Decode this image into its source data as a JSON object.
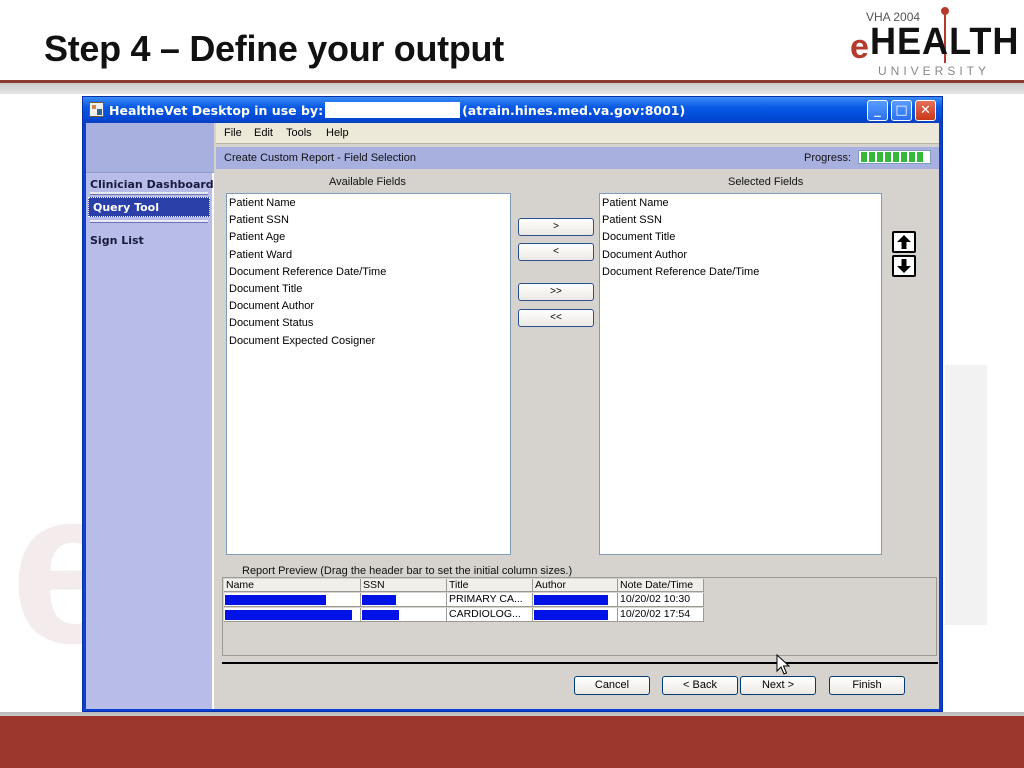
{
  "slide": {
    "title": "Step 4 – Define your output",
    "logo": {
      "top": "VHA 2004",
      "e": "e",
      "main": "HEALTH",
      "sub": "UNIVERSITY"
    }
  },
  "window": {
    "title_prefix": "HealtheVet Desktop in use by:",
    "title_suffix": "(atrain.hines.med.va.gov:8001)",
    "controls": {
      "minimize": "_",
      "maximize": "□",
      "close": "✕"
    }
  },
  "sidebar": {
    "items": [
      {
        "label": "Clinician Dashboard"
      },
      {
        "label": "Query Tool"
      },
      {
        "label": "Sign List"
      }
    ]
  },
  "menu": [
    {
      "label": "File"
    },
    {
      "label": "Edit"
    },
    {
      "label": "Tools"
    },
    {
      "label": "Help"
    }
  ],
  "header": {
    "title": "Create Custom Report - Field Selection",
    "progress_label": "Progress:",
    "progress_value": 0.95
  },
  "available": {
    "label": "Available Fields",
    "items": [
      "Patient Name",
      "Patient SSN",
      "Patient Age",
      "Patient Ward",
      "Document Reference Date/Time",
      "Document Title",
      "Document Author",
      "Document Status",
      "Document Expected Cosigner"
    ]
  },
  "selected": {
    "label": "Selected Fields",
    "items": [
      "Patient Name",
      "Patient SSN",
      "Document Title",
      "Document Author",
      "Document Reference Date/Time"
    ]
  },
  "move_buttons": {
    "add": ">",
    "remove": "<",
    "add_all": ">>",
    "remove_all": "<<"
  },
  "order_buttons": {
    "up": "🡅",
    "down": "🡇"
  },
  "preview": {
    "label": "Report Preview   (Drag the header bar to set the initial column sizes.)",
    "columns": [
      "Name",
      "SSN",
      "Title",
      "Author",
      "Note Date/Time"
    ],
    "rows": [
      {
        "title": "PRIMARY CA...",
        "date": "10/20/02 10:30"
      },
      {
        "title": "CARDIOLOG...",
        "date": "10/20/02 17:54"
      }
    ]
  },
  "wizard_buttons": {
    "cancel": "Cancel",
    "back": "< Back",
    "next": "Next >",
    "finish": "Finish"
  },
  "colors": {
    "titlebar": "#0a59e3",
    "sidebar": "#b7bde8",
    "redaction": "#0012e6",
    "progress": "#36b83a",
    "brand_red": "#9b372c"
  }
}
